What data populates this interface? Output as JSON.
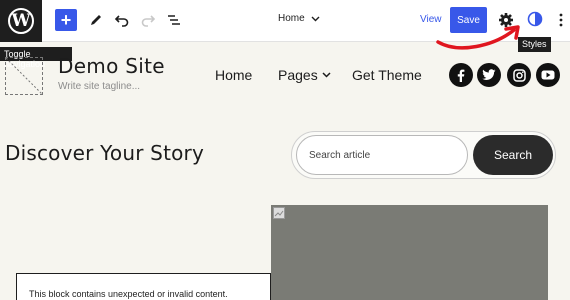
{
  "toolbar": {
    "logo_glyph": "W",
    "add_glyph": "+",
    "document_title": "Home",
    "view_label": "View",
    "save_label": "Save"
  },
  "tooltips": {
    "toggle_navigation": "Toggle navigation",
    "styles": "Styles"
  },
  "site": {
    "title": "Demo Site",
    "tagline": "Write site tagline...",
    "nav": [
      {
        "label": "Home"
      },
      {
        "label": "Pages",
        "has_dropdown": true
      },
      {
        "label": "Get Theme"
      }
    ],
    "social_icons": [
      "facebook-icon",
      "twitter-icon",
      "instagram-icon",
      "youtube-icon"
    ]
  },
  "content": {
    "heading": "Discover Your Story",
    "search_placeholder": "Search article",
    "search_button": "Search",
    "warning_text": "This block contains unexpected or invalid content."
  },
  "colors": {
    "accent": "#3858e9",
    "annotation": "#e0161f",
    "page_bg": "#f6f5ef",
    "dark": "#1e1e1e"
  }
}
